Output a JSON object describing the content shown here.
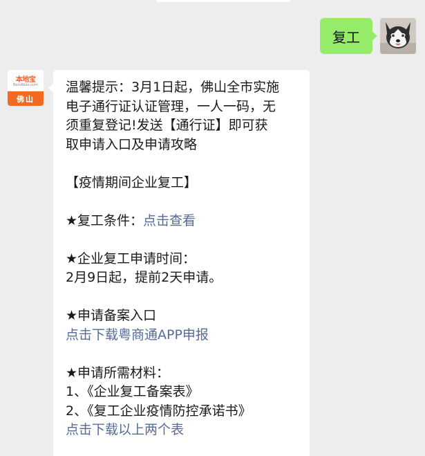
{
  "outgoing": {
    "text": "复工"
  },
  "incoming": {
    "logo": {
      "name": "本地宝",
      "url": "Bendibao.com",
      "city": "佛山"
    },
    "lines": {
      "l1": "温馨提示：3月1日起，佛山全市实施",
      "l2": "电子通行证认证管理，一人一码，无",
      "l3": "须重复登记!发送【通行证】即可获",
      "l4": "取申请入口及申请攻略",
      "heading": "【疫情期间企业复工】",
      "cond_label": "★复工条件：",
      "cond_link": "点击查看",
      "time_label": "★企业复工申请时间：",
      "time_value": "2月9日起，提前2天申请。",
      "entry_label": "★申请备案入口",
      "entry_link": "点击下载粤商通APP申报",
      "materials_label": "★申请所需材料：",
      "material_1": "1、《企业复工备案表》",
      "material_2": "2、《复工企业疫情防控承诺书》",
      "download_link": "点击下载以上两个表"
    }
  },
  "colors": {
    "background": "#ededed",
    "outgoing_bubble": "#95ec69",
    "incoming_bubble": "#ffffff",
    "link": "#576b95",
    "logo_orange": "#f26a21"
  }
}
